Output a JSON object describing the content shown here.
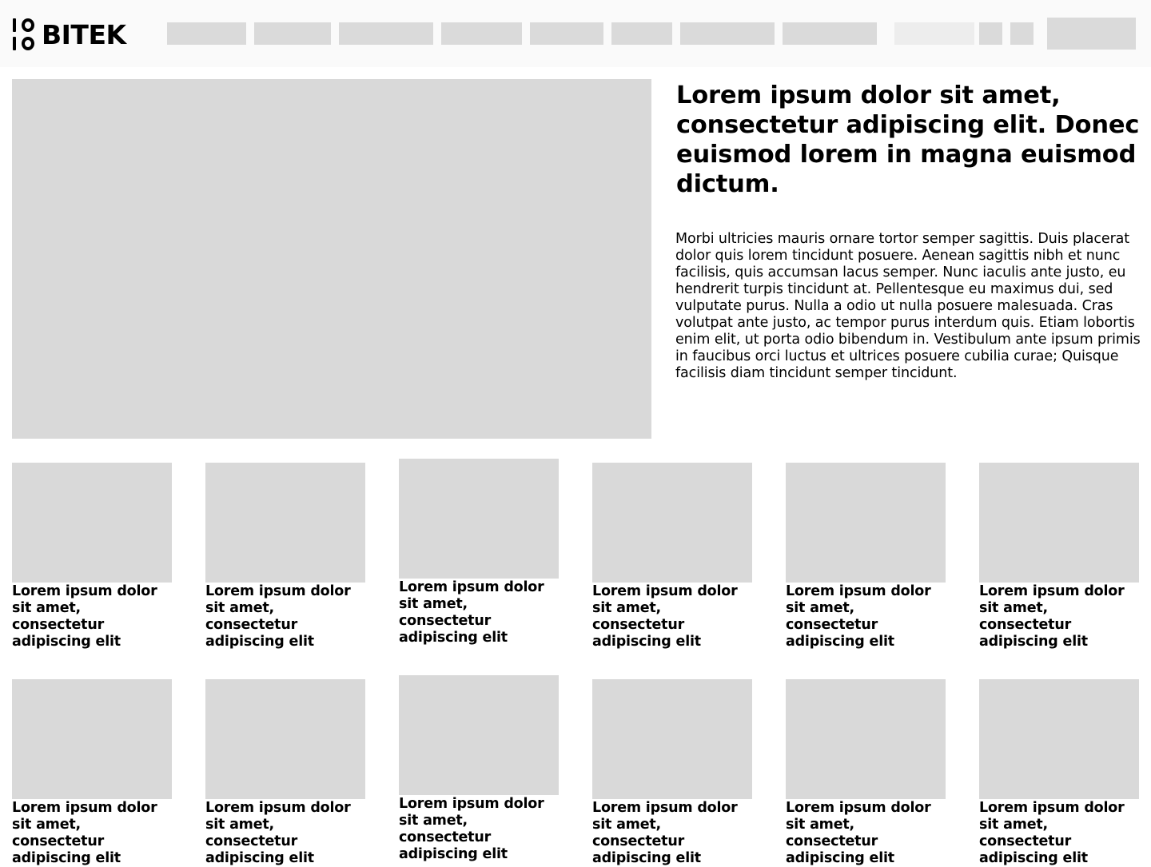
{
  "header": {
    "brand": "BITEK",
    "logo_mark": "10 10"
  },
  "hero": {
    "title": "Lorem ipsum dolor sit amet, consectetur adipiscing elit. Donec euismod lorem in magna euismod dictum.",
    "body": "Morbi ultricies mauris ornare tortor semper sagittis. Duis placerat dolor quis lorem tincidunt posuere. Aenean sagittis nibh et nunc facilisis, quis accumsan lacus semper. Nunc iaculis ante justo, eu hendrerit turpis tincidunt at. Pellentesque eu maximus dui, sed vulputate purus. Nulla a odio ut nulla posuere malesuada. Cras volutpat ante justo, ac tempor purus interdum quis. Etiam lobortis enim elit, ut porta odio bibendum in. Vestibulum ante ipsum primis in faucibus orci luctus et ultrices posuere cubilia curae; Quisque facilisis diam tincidunt semper tincidunt."
  },
  "cards_row1": [
    {
      "title": "Lorem ipsum dolor sit amet, consectetur adipiscing elit"
    },
    {
      "title": "Lorem ipsum dolor sit amet, consectetur adipiscing elit"
    },
    {
      "title": "Lorem ipsum dolor sit amet, consectetur adipiscing elit"
    },
    {
      "title": "Lorem ipsum dolor sit amet, consectetur adipiscing elit"
    },
    {
      "title": "Lorem ipsum dolor sit amet, consectetur adipiscing elit"
    },
    {
      "title": "Lorem ipsum dolor sit amet, consectetur adipiscing elit"
    }
  ],
  "cards_row2": [
    {
      "title": "Lorem ipsum dolor sit amet, consectetur adipiscing elit"
    },
    {
      "title": "Lorem ipsum dolor sit amet, consectetur adipiscing elit"
    },
    {
      "title": "Lorem ipsum dolor sit amet, consectetur adipiscing elit"
    },
    {
      "title": "Lorem ipsum dolor sit amet, consectetur adipiscing elit"
    },
    {
      "title": "Lorem ipsum dolor sit amet, consectetur adipiscing elit"
    },
    {
      "title": "Lorem ipsum dolor sit amet, consectetur adipiscing elit"
    }
  ],
  "colors": {
    "header_bg": "#fafafa",
    "placeholder": "#d9d9d9",
    "text": "#000000"
  }
}
